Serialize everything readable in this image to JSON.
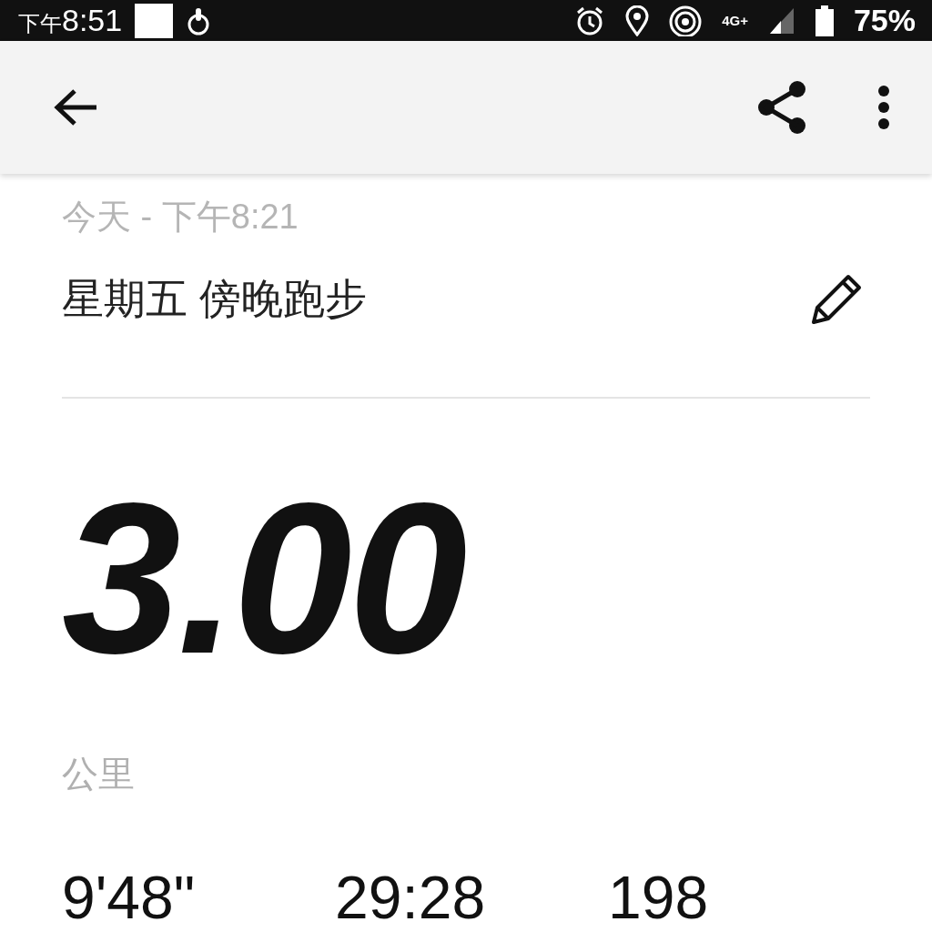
{
  "status_bar": {
    "time_prefix": "下午",
    "time": "8:51",
    "network": "4G+",
    "battery": "75%"
  },
  "run": {
    "date": "今天 - 下午8:21",
    "title": "星期五 傍晚跑步",
    "distance": "3.00",
    "unit": "公里",
    "stats": [
      "9'48\"",
      "29:28",
      "198"
    ]
  }
}
